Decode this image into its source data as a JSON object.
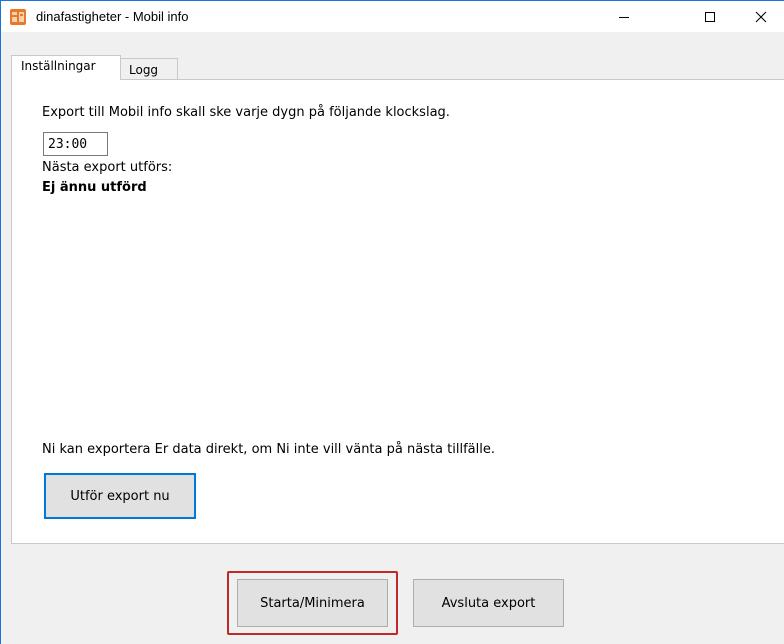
{
  "window": {
    "title": "dinafastigheter - Mobil info",
    "icon": "app-icon",
    "controls": [
      "minimize-icon",
      "maximize-icon",
      "close-icon"
    ]
  },
  "tabs": [
    {
      "label": "Inställningar",
      "active": true
    },
    {
      "label": "Logg",
      "active": false
    }
  ],
  "settings": {
    "schedule_text": "Export till Mobil info skall ske varje dygn på följande klockslag.",
    "time_value": "23:00",
    "next_export_label": "Nästa export utförs:",
    "next_export_value": "Ej ännu utförd",
    "direct_export_text": "Ni kan exportera Er data direkt, om Ni inte vill vänta på nästa tillfälle.",
    "export_now_label": "Utför export nu"
  },
  "footer": {
    "start_label": "Starta/Minimera",
    "quit_label": "Avsluta export"
  },
  "colors": {
    "accent_blue": "#0078d7",
    "highlight_red": "#c0282a",
    "icon_orange": "#e8782a"
  }
}
